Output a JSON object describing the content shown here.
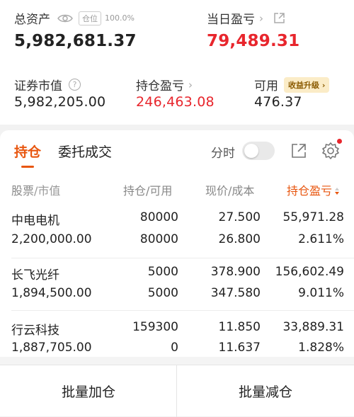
{
  "summary": {
    "total_assets_label": "总资产",
    "position_tag": "仓位",
    "position_pct": "100.0%",
    "total_assets": "5,982,681.37",
    "daily_pnl_label": "当日盈亏",
    "daily_pnl": "79,489.31",
    "market_value_label": "证券市值",
    "market_value": "5,982,205.00",
    "holding_pnl_label": "持仓盈亏",
    "holding_pnl": "246,463.08",
    "available_label": "可用",
    "upgrade_badge": "收益升级",
    "available": "476.37"
  },
  "tabs": {
    "holdings": "持仓",
    "orders": "委托成交",
    "fenshi": "分时"
  },
  "table": {
    "headers": {
      "stock": "股票",
      "value": "/市值",
      "holding": "持仓",
      "available": "/可用",
      "price": "现价",
      "cost": "/成本",
      "pnl": "持仓盈亏"
    },
    "rows": [
      {
        "name": "中电电机",
        "market_value": "2,200,000.00",
        "holding": "80000",
        "available": "80000",
        "price": "27.500",
        "cost": "26.800",
        "pnl": "55,971.28",
        "pnl_pct": "2.611%"
      },
      {
        "name": "长飞光纤",
        "market_value": "1,894,500.00",
        "holding": "5000",
        "available": "5000",
        "price": "378.900",
        "cost": "347.580",
        "pnl": "156,602.49",
        "pnl_pct": "9.011%"
      },
      {
        "name": "行云科技",
        "market_value": "1,887,705.00",
        "holding": "159300",
        "available": "0",
        "price": "11.850",
        "cost": "11.637",
        "pnl": "33,889.31",
        "pnl_pct": "1.828%"
      }
    ]
  },
  "actions": {
    "batch_add": "批量加仓",
    "batch_reduce": "批量减仓"
  },
  "colors": {
    "profit": "#e8262d",
    "accent": "#e8560f"
  }
}
